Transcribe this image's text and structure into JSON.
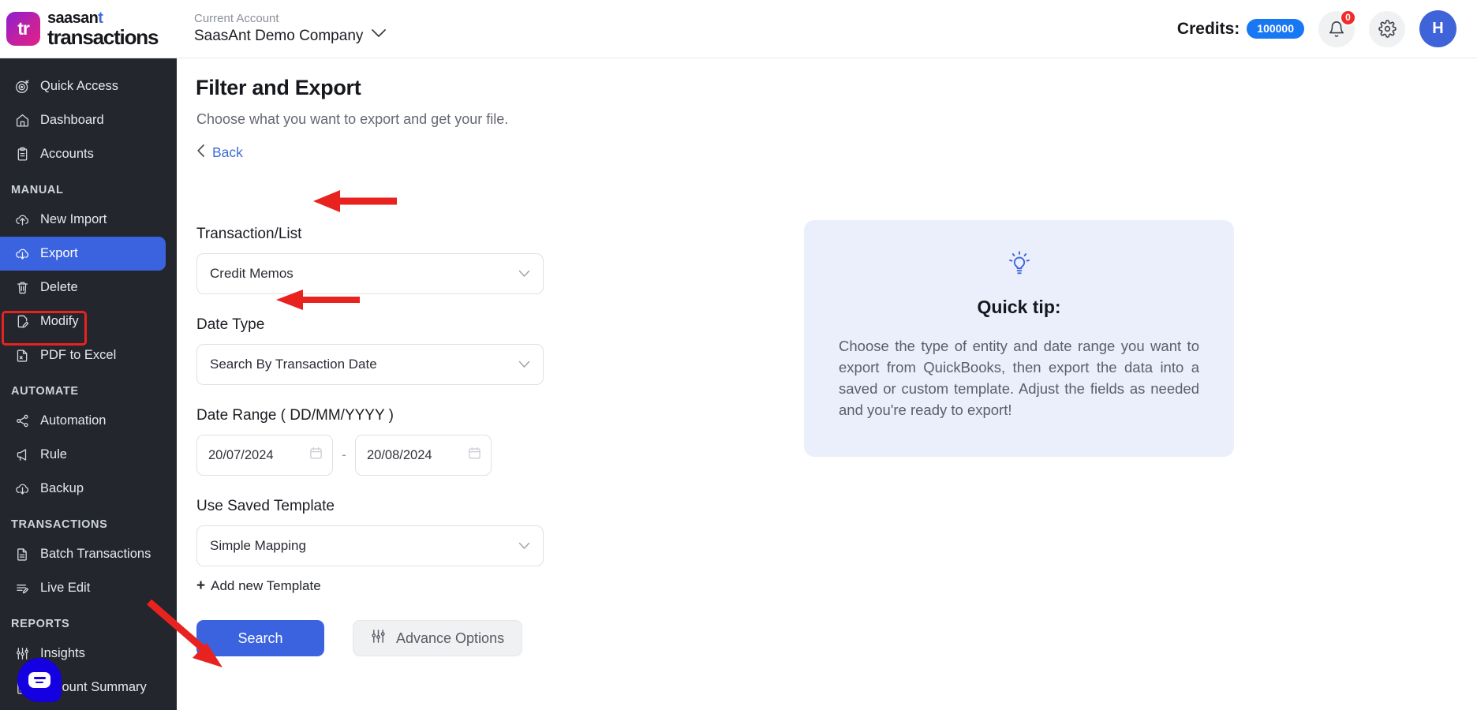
{
  "header": {
    "brand_top": "saasant",
    "brand_top_accent": "t",
    "brand_bottom": "transactions",
    "brand_mark": "tr",
    "account_label": "Current Account",
    "account_name": "SaasAnt Demo Company",
    "credits_label": "Credits:",
    "credits_value": "100000",
    "notification_count": "0",
    "avatar_initial": "H"
  },
  "sidebar": {
    "items": [
      {
        "label": "Quick Access",
        "icon": "target-icon",
        "active": false
      },
      {
        "label": "Dashboard",
        "icon": "home-icon",
        "active": false
      },
      {
        "label": "Accounts",
        "icon": "clipboard-icon",
        "active": false
      }
    ],
    "groups": [
      {
        "title": "MANUAL",
        "items": [
          {
            "label": "New Import",
            "icon": "cloud-upload-icon",
            "active": false
          },
          {
            "label": "Export",
            "icon": "cloud-download-icon",
            "active": true
          },
          {
            "label": "Delete",
            "icon": "trash-icon",
            "active": false
          },
          {
            "label": "Modify",
            "icon": "file-edit-icon",
            "active": false
          },
          {
            "label": "PDF to Excel",
            "icon": "pdf-file-icon",
            "active": false
          }
        ]
      },
      {
        "title": "AUTOMATE",
        "items": [
          {
            "label": "Automation",
            "icon": "share-nodes-icon",
            "active": false
          },
          {
            "label": "Rule",
            "icon": "megaphone-icon",
            "active": false
          },
          {
            "label": "Backup",
            "icon": "cloud-download-icon",
            "active": false
          }
        ]
      },
      {
        "title": "TRANSACTIONS",
        "items": [
          {
            "label": "Batch Transactions",
            "icon": "document-icon",
            "active": false
          },
          {
            "label": "Live Edit",
            "icon": "edit-lines-icon",
            "active": false
          }
        ]
      },
      {
        "title": "REPORTS",
        "items": [
          {
            "label": "Insights",
            "icon": "sliders-icon",
            "active": false
          },
          {
            "label": "Account Summary",
            "icon": "report-icon",
            "active": false
          }
        ]
      }
    ]
  },
  "main": {
    "title": "Filter and Export",
    "subtitle": "Choose what you want to export and get your file.",
    "back_label": "Back",
    "fields": {
      "transaction_list": {
        "label": "Transaction/List",
        "value": "Credit Memos"
      },
      "date_type": {
        "label": "Date Type",
        "value": "Search By Transaction Date"
      },
      "date_range": {
        "label": "Date Range ( DD/MM/YYYY )",
        "from": "20/07/2024",
        "to": "20/08/2024",
        "separator": "-"
      },
      "saved_template": {
        "label": "Use Saved Template",
        "value": "Simple Mapping"
      }
    },
    "add_template_label": "Add new Template",
    "search_button": "Search",
    "advance_options_button": "Advance Options"
  },
  "tip": {
    "title": "Quick tip:",
    "body": "Choose the type of entity and date range you want to export from QuickBooks, then export the data into a saved or custom template. Adjust the fields as needed and you're ready to export!"
  },
  "colors": {
    "accent_blue": "#3b63e0",
    "sidebar_bg": "#23262d",
    "tip_bg": "#eaeffb",
    "annotation_red": "#e8231f",
    "credits_pill": "#1877f2",
    "badge_red": "#ef2b2b"
  }
}
